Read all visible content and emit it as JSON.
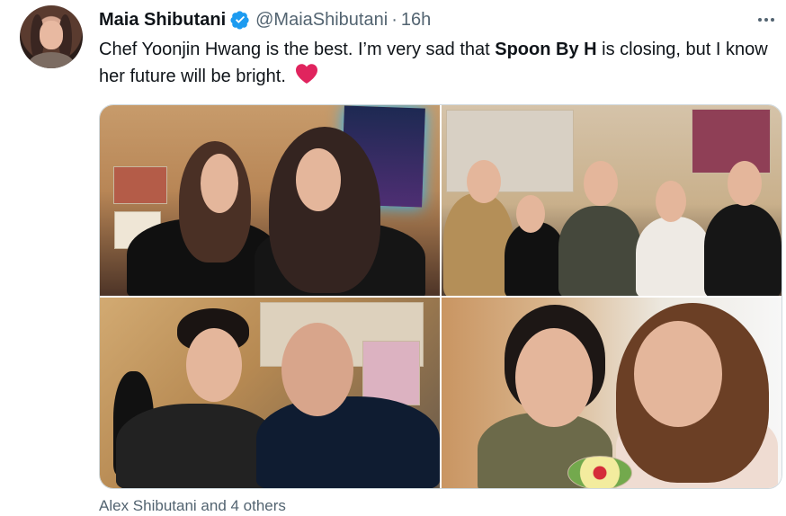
{
  "post": {
    "author_name": "Maia Shibutani",
    "handle": "@MaiaShibutani",
    "separator": "·",
    "time": "16h",
    "text_prefix": "Chef Yoonjin Hwang is the best. I’m very sad that ",
    "text_bold": "Spoon By H",
    "text_suffix": " is closing, but I know her future will be bright."
  },
  "engagement": {
    "liked_by": "Alex Shibutani and 4 others"
  },
  "icons": {
    "verified": "verified-badge-icon",
    "more": "more-options-icon",
    "heart": "red-heart-emoji-icon"
  },
  "colors": {
    "primary_text": "#0f1419",
    "secondary_text": "#536471",
    "verified_blue": "#1d9bf0",
    "heart_red": "#e0245e",
    "media_border": "#cfd9de"
  }
}
